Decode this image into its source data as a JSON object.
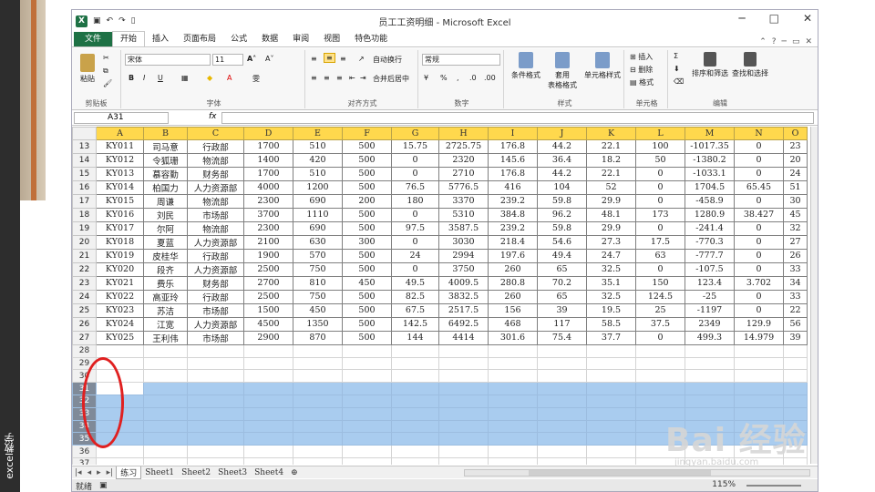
{
  "sidebar": {
    "text": "excel教学"
  },
  "window": {
    "title": "员工工资明细 - Microsoft Excel",
    "min": "─",
    "max": "□",
    "close": "✕"
  },
  "tabs": [
    "文件",
    "开始",
    "插入",
    "页面布局",
    "公式",
    "数据",
    "审阅",
    "视图",
    "特色功能"
  ],
  "ribbon": {
    "paste": "粘贴",
    "font_name": "宋体",
    "font_size": "11",
    "wrap": "自动换行",
    "merge": "合并后居中",
    "number_format": "常规",
    "cond_format": "条件格式",
    "table_format_l1": "套用",
    "table_format_l2": "表格格式",
    "cell_style": "单元格样式",
    "insert": "插入",
    "delete": "删除",
    "format": "格式",
    "sort_filter": "排序和筛选",
    "find_select": "查找和选择",
    "groups": [
      "剪贴板",
      "字体",
      "对齐方式",
      "数字",
      "样式",
      "单元格",
      "编辑"
    ]
  },
  "formula_bar": {
    "name_box": "A31",
    "fx": "fx",
    "content": ""
  },
  "columns": [
    "A",
    "B",
    "C",
    "D",
    "E",
    "F",
    "G",
    "H",
    "I",
    "J",
    "K",
    "L",
    "M",
    "N",
    "O"
  ],
  "rows": [
    {
      "n": "13",
      "c": [
        "KY011",
        "司马意",
        "行政部",
        "1700",
        "510",
        "500",
        "15.75",
        "2725.75",
        "176.8",
        "44.2",
        "22.1",
        "100",
        "-1017.35",
        "0",
        "23"
      ]
    },
    {
      "n": "14",
      "c": [
        "KY012",
        "令狐珊",
        "物流部",
        "1400",
        "420",
        "500",
        "0",
        "2320",
        "145.6",
        "36.4",
        "18.2",
        "50",
        "-1380.2",
        "0",
        "20"
      ]
    },
    {
      "n": "15",
      "c": [
        "KY013",
        "慕容勤",
        "财务部",
        "1700",
        "510",
        "500",
        "0",
        "2710",
        "176.8",
        "44.2",
        "22.1",
        "0",
        "-1033.1",
        "0",
        "24"
      ]
    },
    {
      "n": "16",
      "c": [
        "KY014",
        "柏国力",
        "人力资源部",
        "4000",
        "1200",
        "500",
        "76.5",
        "5776.5",
        "416",
        "104",
        "52",
        "0",
        "1704.5",
        "65.45",
        "51"
      ]
    },
    {
      "n": "17",
      "c": [
        "KY015",
        "周谦",
        "物流部",
        "2300",
        "690",
        "200",
        "180",
        "3370",
        "239.2",
        "59.8",
        "29.9",
        "0",
        "-458.9",
        "0",
        "30"
      ]
    },
    {
      "n": "18",
      "c": [
        "KY016",
        "刘民",
        "市场部",
        "3700",
        "1110",
        "500",
        "0",
        "5310",
        "384.8",
        "96.2",
        "48.1",
        "173",
        "1280.9",
        "38.427",
        "45"
      ]
    },
    {
      "n": "19",
      "c": [
        "KY017",
        "尔阿",
        "物流部",
        "2300",
        "690",
        "500",
        "97.5",
        "3587.5",
        "239.2",
        "59.8",
        "29.9",
        "0",
        "-241.4",
        "0",
        "32"
      ]
    },
    {
      "n": "20",
      "c": [
        "KY018",
        "夏蓝",
        "人力资源部",
        "2100",
        "630",
        "300",
        "0",
        "3030",
        "218.4",
        "54.6",
        "27.3",
        "17.5",
        "-770.3",
        "0",
        "27"
      ]
    },
    {
      "n": "21",
      "c": [
        "KY019",
        "皮桂华",
        "行政部",
        "1900",
        "570",
        "500",
        "24",
        "2994",
        "197.6",
        "49.4",
        "24.7",
        "63",
        "-777.7",
        "0",
        "26"
      ]
    },
    {
      "n": "22",
      "c": [
        "KY020",
        "段齐",
        "人力资源部",
        "2500",
        "750",
        "500",
        "0",
        "3750",
        "260",
        "65",
        "32.5",
        "0",
        "-107.5",
        "0",
        "33"
      ]
    },
    {
      "n": "23",
      "c": [
        "KY021",
        "费乐",
        "财务部",
        "2700",
        "810",
        "450",
        "49.5",
        "4009.5",
        "280.8",
        "70.2",
        "35.1",
        "150",
        "123.4",
        "3.702",
        "34"
      ]
    },
    {
      "n": "24",
      "c": [
        "KY022",
        "高亚玲",
        "行政部",
        "2500",
        "750",
        "500",
        "82.5",
        "3832.5",
        "260",
        "65",
        "32.5",
        "124.5",
        "-25",
        "0",
        "33"
      ]
    },
    {
      "n": "25",
      "c": [
        "KY023",
        "苏洁",
        "市场部",
        "1500",
        "450",
        "500",
        "67.5",
        "2517.5",
        "156",
        "39",
        "19.5",
        "25",
        "-1197",
        "0",
        "22"
      ]
    },
    {
      "n": "26",
      "c": [
        "KY024",
        "江宽",
        "人力资源部",
        "4500",
        "1350",
        "500",
        "142.5",
        "6492.5",
        "468",
        "117",
        "58.5",
        "37.5",
        "2349",
        "129.9",
        "56"
      ]
    },
    {
      "n": "27",
      "c": [
        "KY025",
        "王利伟",
        "市场部",
        "2900",
        "870",
        "500",
        "144",
        "4414",
        "301.6",
        "75.4",
        "37.7",
        "0",
        "499.3",
        "14.979",
        "39"
      ]
    }
  ],
  "empty_rows": [
    "28",
    "29",
    "30"
  ],
  "selected_rows": [
    "31",
    "32",
    "33",
    "34",
    "35"
  ],
  "after_rows": [
    "36",
    "37"
  ],
  "sheet_tabs": [
    "练习",
    "Sheet1",
    "Sheet2",
    "Sheet3",
    "Sheet4"
  ],
  "status": {
    "ready": "就绪",
    "zoom": "115%"
  },
  "watermark": {
    "big": "Bai 经验",
    "small": "jingyan.baidu.com"
  },
  "colors": {
    "header_fill": "#ffd84d",
    "selection": "#a9ccef",
    "file_tab": "#1e7145",
    "annotation": "#e02020"
  }
}
